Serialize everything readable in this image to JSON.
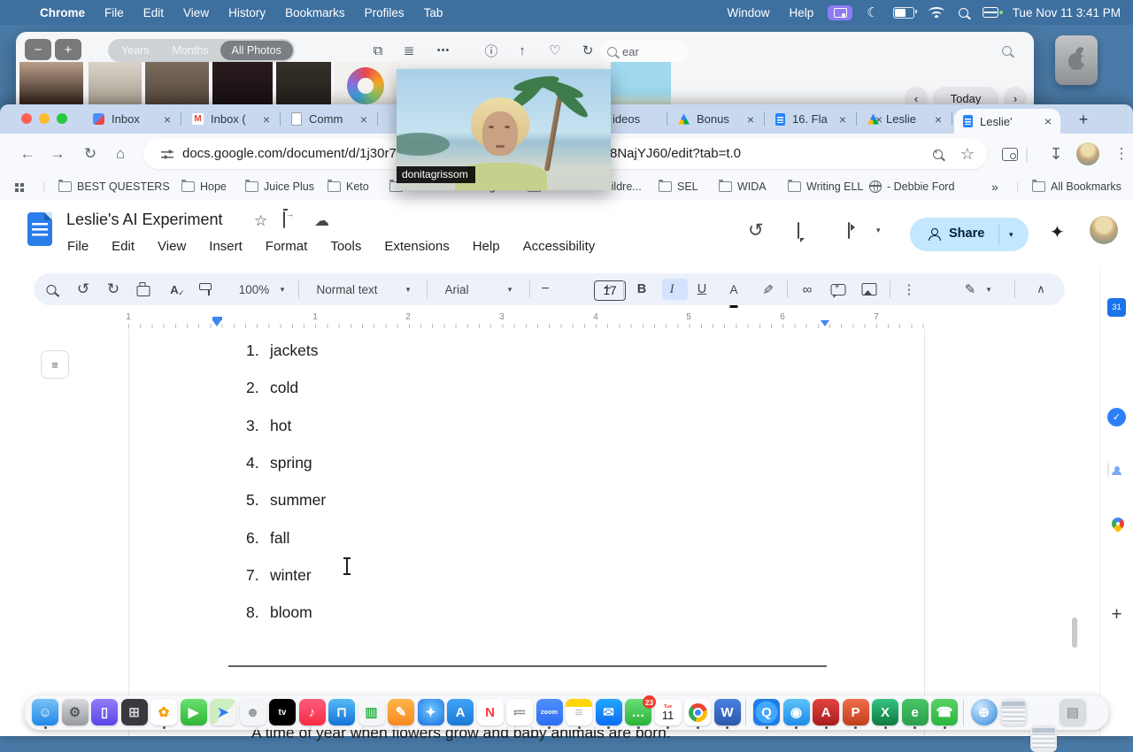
{
  "menubar": {
    "apple": "",
    "items": [
      "Chrome",
      "File",
      "Edit",
      "View",
      "History",
      "Bookmarks",
      "Profiles",
      "Tab"
    ],
    "right_items": [
      "Window",
      "Help"
    ],
    "clock": "Tue Nov 11  3:41 PM"
  },
  "photos": {
    "zoom_out": "−",
    "zoom_in": "+",
    "segments": [
      "Years",
      "Months",
      "All Photos"
    ],
    "selected_segment": "All Photos",
    "more_label": "•••",
    "info_icon": "ⓘ",
    "search_fragment": "ear",
    "today_label": "Today",
    "prev": "‹",
    "next": "›"
  },
  "overlay": {
    "name": "donitagrissom"
  },
  "chrome": {
    "tabs": [
      {
        "label": "Inbox",
        "favicon": "spark",
        "active": false
      },
      {
        "label": "Inbox (",
        "favicon": "gmail",
        "active": false
      },
      {
        "label": "Comm",
        "favicon": "docgray",
        "active": false
      },
      {
        "label": "ideos",
        "favicon": "none",
        "active": false
      },
      {
        "label": "Bonus",
        "favicon": "drive",
        "active": false
      },
      {
        "label": "16. Fla",
        "favicon": "docs",
        "active": false
      },
      {
        "label": "Leslie",
        "favicon": "drive",
        "active": false
      },
      {
        "label": "Leslie'",
        "favicon": "docs",
        "active": true
      }
    ],
    "new_tab": "+",
    "url_left": "docs.google.com/document/d/1j30r7K",
    "url_right": "8NajYJ60/edit?tab=t.0",
    "bookmarks": [
      "BEST QUESTERS",
      "Hope",
      "Juice Plus",
      "Keto",
      "Live Your Message",
      "Northland Childre...",
      "SEL",
      "WIDA",
      "Writing ELL",
      "- Debbie Ford"
    ],
    "overflow": "»",
    "all_bookmarks": "All Bookmarks"
  },
  "docs": {
    "title": "Leslie's AI Experiment",
    "menus": [
      "File",
      "Edit",
      "View",
      "Insert",
      "Format",
      "Tools",
      "Extensions",
      "Help",
      "Accessibility"
    ],
    "share_label": "Share",
    "toolbar": {
      "zoom": "100%",
      "style": "Normal text",
      "font": "Arial",
      "size": "17",
      "bold": "B",
      "italic": "I",
      "underline": "U",
      "color": "A"
    },
    "ruler_numbers": [
      "1",
      "1",
      "2",
      "3",
      "4",
      "5",
      "6",
      "7"
    ],
    "list_items": [
      "jackets",
      "cold",
      "hot",
      "spring",
      "summer",
      "fall",
      "winter",
      "bloom"
    ],
    "bottom_sentence": "A time of year when flowers grow and baby animals are born.",
    "accent": "#c2e7ff",
    "bold_active_bg": "#d3e3fd"
  },
  "dock": {
    "calendar_weekday": "Tue",
    "calendar_day": "11",
    "messages_badge": "23",
    "apps": [
      {
        "name": "finder",
        "glyph": "☺",
        "bg": "linear-gradient(180deg,#7ac1f7,#2188e8)",
        "fg": "#ffffff",
        "running": true
      },
      {
        "name": "system-settings",
        "glyph": "⚙",
        "bg": "linear-gradient(180deg,#d9dbdd,#97999e)",
        "fg": "#55585e"
      },
      {
        "name": "iphone-mirroring",
        "glyph": "▯",
        "bg": "linear-gradient(180deg,#8f7df8,#5c45ea)",
        "fg": "#ffffff"
      },
      {
        "name": "launchpad",
        "glyph": "⊞",
        "bg": "#39393d",
        "fg": "#d0d3d8"
      },
      {
        "name": "photos",
        "glyph": "✿",
        "bg": "#ffffff",
        "fg": "#f59e0b",
        "running": true
      },
      {
        "name": "facetime",
        "glyph": "▶",
        "bg": "linear-gradient(180deg,#69e06e,#2eb637)",
        "fg": "#ffffff"
      },
      {
        "name": "maps",
        "glyph": "➤",
        "bg": "linear-gradient(135deg,#cdeec0 55%,#f3f5f4 55%)",
        "fg": "#2f7bf6"
      },
      {
        "name": "contacts",
        "glyph": "☻",
        "bg": "#f3f4f5",
        "fg": "#90959b"
      },
      {
        "name": "apple-tv",
        "glyph": "tv",
        "bg": "#000000",
        "fg": "#ffffff",
        "fs": 10
      },
      {
        "name": "music",
        "glyph": "♪",
        "bg": "linear-gradient(180deg,#fc5c7d,#f72c44)",
        "fg": "#ffffff"
      },
      {
        "name": "keynote",
        "glyph": "⊓",
        "bg": "linear-gradient(180deg,#55baf6,#1372d8)",
        "fg": "#ffffff"
      },
      {
        "name": "numbers",
        "glyph": "▥",
        "bg": "#f5f6f7",
        "fg": "#31b14c"
      },
      {
        "name": "pages",
        "glyph": "✎",
        "bg": "linear-gradient(180deg,#ffb64a,#f6891f)",
        "fg": "#ffffff"
      },
      {
        "name": "safari",
        "glyph": "✦",
        "bg": "radial-gradient(circle at 50% 40%,#6cc9ff,#1e6ee0)",
        "fg": "#ffffff"
      },
      {
        "name": "app-store",
        "glyph": "A",
        "bg": "linear-gradient(180deg,#3fa4f5,#1b79d4)",
        "fg": "#ffffff"
      },
      {
        "name": "news",
        "glyph": "N",
        "bg": "#ffffff",
        "fg": "#fb3b49"
      },
      {
        "name": "reminders",
        "glyph": "≔",
        "bg": "#ffffff",
        "fg": "#8a8f96"
      },
      {
        "name": "zoom",
        "glyph": "zoom",
        "bg": "linear-gradient(180deg,#4e8ffd,#2e6ef2)",
        "fg": "#ffffff",
        "fs": 7,
        "running": true
      },
      {
        "name": "notes",
        "glyph": "≡",
        "bg": "linear-gradient(180deg,#ffd60a 30%,#ffffff 30%)",
        "fg": "#b4b8bd",
        "running": true
      },
      {
        "name": "mail",
        "glyph": "✉",
        "bg": "linear-gradient(180deg,#23a7ff,#0b6ef4)",
        "fg": "#ffffff",
        "running": true
      },
      {
        "name": "messages",
        "glyph": "…",
        "bg": "linear-gradient(180deg,#68df75,#2ab338)",
        "fg": "#ffffff",
        "badge": "23",
        "running": true
      },
      {
        "name": "calendar",
        "special": "calendar",
        "bg": "#ffffff",
        "running": true
      },
      {
        "name": "chrome",
        "special": "chrome",
        "bg": "#ffffff",
        "running": true
      },
      {
        "name": "word",
        "glyph": "W",
        "bg": "linear-gradient(180deg,#4b80e2,#2b59a9)",
        "fg": "#ffffff",
        "running": true
      },
      {
        "divider": true
      },
      {
        "name": "quicktime",
        "glyph": "Q",
        "bg": "radial-gradient(circle,#42a7ff 58%,#1e7de8 60%)",
        "fg": "#ffffff",
        "running": true
      },
      {
        "name": "photo-booth",
        "glyph": "◉",
        "bg": "linear-gradient(180deg,#5cc2f8,#1f8ce8)",
        "fg": "#ffffff",
        "running": true
      },
      {
        "name": "acrobat",
        "glyph": "A",
        "bg": "linear-gradient(180deg,#e24440,#a81e1d)",
        "fg": "#ffffff",
        "running": true
      },
      {
        "name": "powerpoint",
        "glyph": "P",
        "bg": "linear-gradient(180deg,#ee6d49,#c23f1e)",
        "fg": "#ffffff",
        "running": true
      },
      {
        "name": "excel",
        "glyph": "X",
        "bg": "linear-gradient(180deg,#35c481,#10793f)",
        "fg": "#ffffff",
        "running": true
      },
      {
        "name": "evernote",
        "glyph": "e",
        "bg": "linear-gradient(180deg,#48c566,#2c9f4b)",
        "fg": "#ffffff",
        "running": true
      },
      {
        "name": "whatsapp",
        "glyph": "☎",
        "bg": "linear-gradient(180deg,#58d264,#2ab63f)",
        "fg": "#ffffff",
        "running": true
      },
      {
        "divider": true
      },
      {
        "name": "network-globe",
        "glyph": "⊕",
        "bg": "radial-gradient(circle at 35% 30%,#cfe9ff,#2f85da)",
        "fg": "#ffffff",
        "round": true
      },
      {
        "name": "minimized-window-1",
        "special": "window"
      },
      {
        "name": "minimized-window-2",
        "special": "window"
      },
      {
        "name": "trash",
        "glyph": "▤",
        "bg": "rgba(214,217,221,.92)",
        "fg": "#9ba0a6"
      }
    ]
  }
}
